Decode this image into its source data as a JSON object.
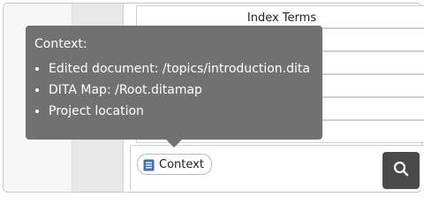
{
  "list": {
    "header": "Index Terms"
  },
  "tooltip": {
    "title": "Context:",
    "items": [
      "Edited document: /topics/introduction.dita",
      "DITA Map: /Root.ditamap",
      "Project location"
    ]
  },
  "context_chip": {
    "label": "Context",
    "icon": "document-icon"
  },
  "search_button": {
    "icon": "search-icon"
  },
  "colors": {
    "tooltip_bg": "#717171",
    "search_button_bg": "#4a4a4a",
    "doc_icon": "#3b6fc5"
  }
}
